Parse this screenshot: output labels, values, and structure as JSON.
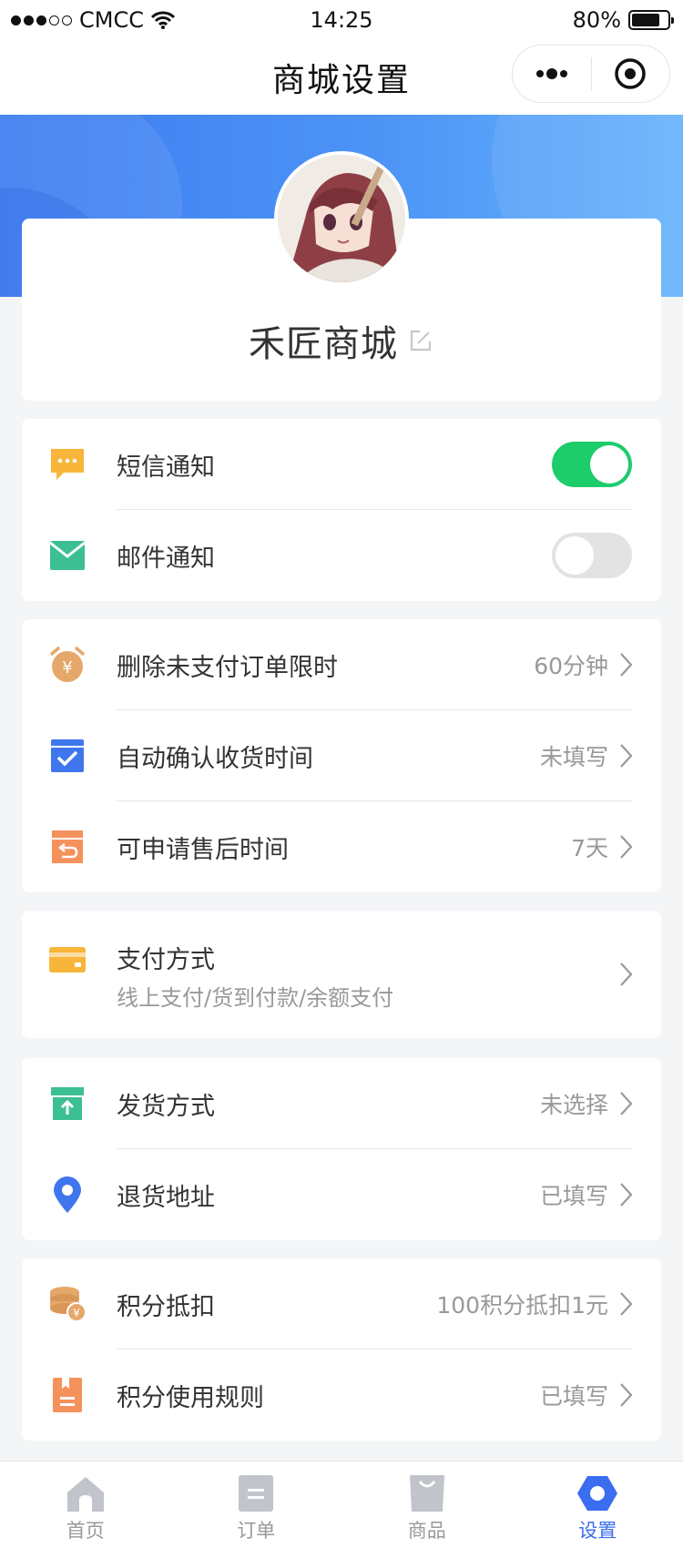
{
  "status_bar": {
    "carrier": "CMCC",
    "time": "14:25",
    "battery": "80%",
    "battery_level": 0.8,
    "signal_dots": [
      true,
      true,
      true,
      false,
      false
    ]
  },
  "nav": {
    "title": "商城设置"
  },
  "profile": {
    "shop_name": "禾匠商城"
  },
  "notifications": [
    {
      "label": "短信通知",
      "enabled": true,
      "icon": "sms-icon"
    },
    {
      "label": "邮件通知",
      "enabled": false,
      "icon": "mail-icon"
    }
  ],
  "order_settings": [
    {
      "label": "删除未支付订单限时",
      "value": "60分钟",
      "icon": "alarm-clock-icon"
    },
    {
      "label": "自动确认收货时间",
      "value": "未填写",
      "icon": "confirm-box-icon"
    },
    {
      "label": "可申请售后时间",
      "value": "7天",
      "icon": "return-icon"
    }
  ],
  "payment": {
    "label": "支付方式",
    "sub": "线上支付/货到付款/余额支付",
    "icon": "wallet-icon"
  },
  "delivery": [
    {
      "label": "发货方式",
      "value": "未选择",
      "icon": "ship-box-icon"
    },
    {
      "label": "退货地址",
      "value": "已填写",
      "icon": "location-pin-icon"
    }
  ],
  "points": [
    {
      "label": "积分抵扣",
      "value": "100积分抵扣1元",
      "icon": "coins-icon"
    },
    {
      "label": "积分使用规则",
      "value": "已填写",
      "icon": "rules-book-icon"
    }
  ],
  "tabs": [
    {
      "label": "首页",
      "icon": "home-icon",
      "active": false
    },
    {
      "label": "订单",
      "icon": "order-icon",
      "active": false
    },
    {
      "label": "商品",
      "icon": "bag-icon",
      "active": false
    },
    {
      "label": "设置",
      "icon": "settings-hex-icon",
      "active": true
    }
  ],
  "colors": {
    "accent": "#3a6df0",
    "toggle_on": "#1dcc6a",
    "banner_start": "#3d7cf0",
    "banner_end": "#67b3fb"
  }
}
